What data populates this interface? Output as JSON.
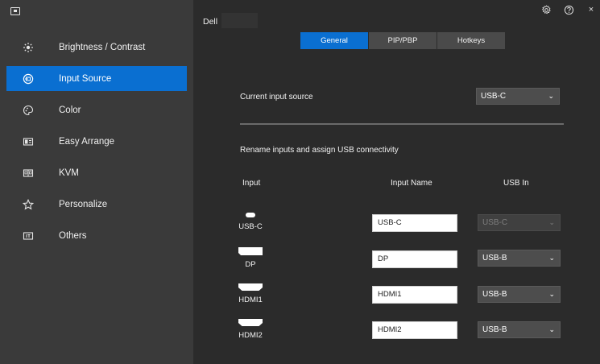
{
  "sidebar": {
    "items": [
      {
        "label": "Brightness / Contrast",
        "icon": "brightness-icon"
      },
      {
        "label": "Input Source",
        "icon": "input-source-icon",
        "active": true
      },
      {
        "label": "Color",
        "icon": "color-palette-icon"
      },
      {
        "label": "Easy Arrange",
        "icon": "easy-arrange-icon"
      },
      {
        "label": "KVM",
        "icon": "kvm-icon"
      },
      {
        "label": "Personalize",
        "icon": "star-icon"
      },
      {
        "label": "Others",
        "icon": "others-icon"
      }
    ]
  },
  "header": {
    "monitor_name": "Dell"
  },
  "tabs": [
    {
      "label": "General",
      "active": true
    },
    {
      "label": "PIP/PBP"
    },
    {
      "label": "Hotkeys"
    }
  ],
  "general": {
    "current_input_label": "Current input source",
    "current_input_value": "USB-C",
    "rename_heading": "Rename inputs and assign USB connectivity",
    "columns": {
      "input": "Input",
      "input_name": "Input Name",
      "usb_in": "USB In"
    },
    "rows": [
      {
        "port": "USB-C",
        "name": "USB-C",
        "usb": "USB-C",
        "usb_disabled": true
      },
      {
        "port": "DP",
        "name": "DP",
        "usb": "USB-B"
      },
      {
        "port": "HDMI1",
        "name": "HDMI1",
        "usb": "USB-B"
      },
      {
        "port": "HDMI2",
        "name": "HDMI2",
        "usb": "USB-B"
      }
    ]
  },
  "colors": {
    "accent": "#0a6fd1",
    "sidebar": "#3a3a3a",
    "main": "#2b2b2b"
  }
}
